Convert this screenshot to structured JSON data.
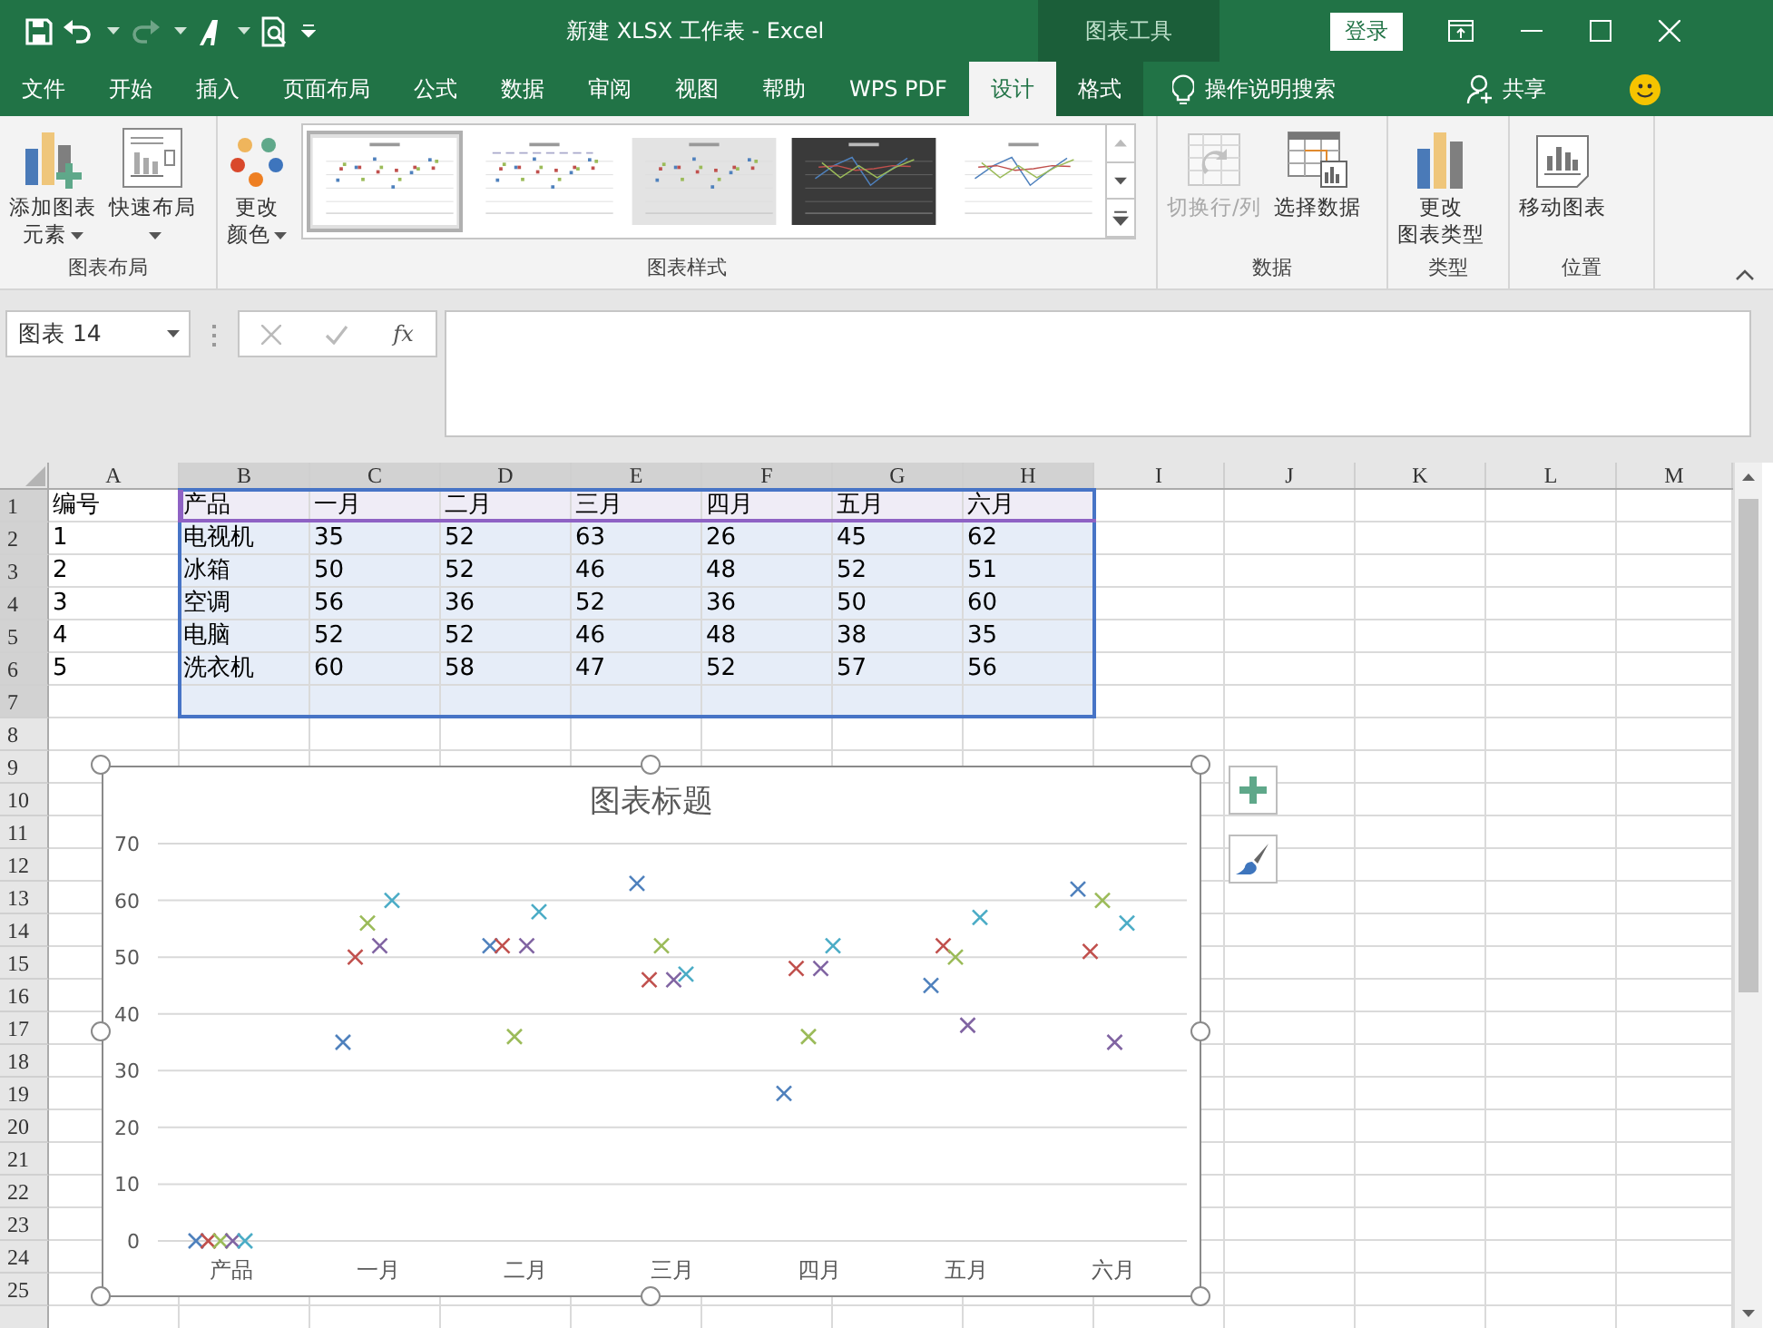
{
  "title_bar": {
    "title": "新建 XLSX 工作表  -  Excel",
    "context_label": "图表工具",
    "sign_in": "登录",
    "redo_disabled": true
  },
  "menu_tabs": [
    {
      "label": "文件",
      "selected": false,
      "context": false
    },
    {
      "label": "开始",
      "selected": false,
      "context": false
    },
    {
      "label": "插入",
      "selected": false,
      "context": false
    },
    {
      "label": "页面布局",
      "selected": false,
      "context": false
    },
    {
      "label": "公式",
      "selected": false,
      "context": false
    },
    {
      "label": "数据",
      "selected": false,
      "context": false
    },
    {
      "label": "审阅",
      "selected": false,
      "context": false
    },
    {
      "label": "视图",
      "selected": false,
      "context": false
    },
    {
      "label": "帮助",
      "selected": false,
      "context": false
    },
    {
      "label": "WPS PDF",
      "selected": false,
      "context": false
    },
    {
      "label": "设计",
      "selected": true,
      "context": true
    },
    {
      "label": "格式",
      "selected": false,
      "context": true
    }
  ],
  "tell_me": "操作说明搜索",
  "share": "共享",
  "ribbon_groups": [
    {
      "label": "图表布局",
      "items": [
        {
          "kind": "button",
          "lines": [
            "添加图表",
            "元素"
          ],
          "dropdown": true,
          "disabled": false
        },
        {
          "kind": "button",
          "lines": [
            "快速布局"
          ],
          "dropdown": true,
          "disabled": false
        }
      ]
    },
    {
      "label": "图表样式",
      "items": [
        {
          "kind": "button",
          "lines": [
            "更改",
            "颜色"
          ],
          "dropdown": true,
          "disabled": false
        },
        {
          "kind": "gallery",
          "styles": [
            {
              "kind": "plain",
              "selected": true
            },
            {
              "kind": "legend",
              "selected": false
            },
            {
              "kind": "gradient",
              "selected": false
            },
            {
              "kind": "dark",
              "selected": false
            },
            {
              "kind": "lines",
              "selected": false
            }
          ]
        }
      ]
    },
    {
      "label": "数据",
      "items": [
        {
          "kind": "button",
          "lines": [
            "切换行/列"
          ],
          "dropdown": false,
          "disabled": true
        },
        {
          "kind": "button",
          "lines": [
            "选择数据"
          ],
          "dropdown": false,
          "disabled": false
        }
      ]
    },
    {
      "label": "类型",
      "items": [
        {
          "kind": "button",
          "lines": [
            "更改",
            "图表类型"
          ],
          "dropdown": false,
          "disabled": false
        }
      ]
    },
    {
      "label": "位置",
      "items": [
        {
          "kind": "button",
          "lines": [
            "移动图表"
          ],
          "dropdown": false,
          "disabled": false
        }
      ]
    }
  ],
  "formula_bar": {
    "name_box": "图表 14",
    "function_label": "fx"
  },
  "sheet": {
    "columns": [
      {
        "letter": "A",
        "in_range": false
      },
      {
        "letter": "B",
        "in_range": true
      },
      {
        "letter": "C",
        "in_range": true
      },
      {
        "letter": "D",
        "in_range": true
      },
      {
        "letter": "E",
        "in_range": true
      },
      {
        "letter": "F",
        "in_range": true
      },
      {
        "letter": "G",
        "in_range": true
      },
      {
        "letter": "H",
        "in_range": true
      },
      {
        "letter": "I",
        "in_range": false
      },
      {
        "letter": "J",
        "in_range": false
      },
      {
        "letter": "K",
        "in_range": false
      },
      {
        "letter": "L",
        "in_range": false
      },
      {
        "letter": "M",
        "in_range": false
      }
    ],
    "rows": [
      {
        "number": "1",
        "in_range": true,
        "names_row": true,
        "cells": [
          "编号",
          "产品",
          "一月",
          "二月",
          "三月",
          "四月",
          "五月",
          "六月"
        ]
      },
      {
        "number": "2",
        "in_range": true,
        "names_row": false,
        "cells": [
          "1",
          "电视机",
          "35",
          "52",
          "63",
          "26",
          "45",
          "62"
        ]
      },
      {
        "number": "3",
        "in_range": true,
        "names_row": false,
        "cells": [
          "2",
          "冰箱",
          "50",
          "52",
          "46",
          "48",
          "52",
          "51"
        ]
      },
      {
        "number": "4",
        "in_range": true,
        "names_row": false,
        "cells": [
          "3",
          "空调",
          "56",
          "36",
          "52",
          "36",
          "50",
          "60"
        ]
      },
      {
        "number": "5",
        "in_range": true,
        "names_row": false,
        "cells": [
          "4",
          "电脑",
          "52",
          "52",
          "46",
          "48",
          "38",
          "35"
        ]
      },
      {
        "number": "6",
        "in_range": true,
        "names_row": false,
        "cells": [
          "5",
          "洗衣机",
          "60",
          "58",
          "47",
          "52",
          "57",
          "56"
        ]
      },
      {
        "number": "7",
        "in_range": true,
        "names_row": false
      },
      {
        "number": "8",
        "in_range": false
      },
      {
        "number": "9",
        "in_range": false
      },
      {
        "number": "10",
        "in_range": false
      },
      {
        "number": "11",
        "in_range": false
      },
      {
        "number": "12",
        "in_range": false
      },
      {
        "number": "13",
        "in_range": false
      },
      {
        "number": "14",
        "in_range": false
      },
      {
        "number": "15",
        "in_range": false
      },
      {
        "number": "16",
        "in_range": false
      },
      {
        "number": "17",
        "in_range": false
      },
      {
        "number": "18",
        "in_range": false
      },
      {
        "number": "19",
        "in_range": false
      },
      {
        "number": "20",
        "in_range": false
      },
      {
        "number": "21",
        "in_range": false
      },
      {
        "number": "22",
        "in_range": false
      },
      {
        "number": "23",
        "in_range": false
      },
      {
        "number": "24",
        "in_range": false
      },
      {
        "number": "25",
        "in_range": false
      }
    ]
  },
  "chart": {
    "title": "图表标题",
    "chart_data": {
      "type": "scatter",
      "grid": true,
      "categories": [
        "产品",
        "一月",
        "二月",
        "三月",
        "四月",
        "五月",
        "六月"
      ],
      "ylim": [
        0,
        70
      ],
      "yticks": [
        0,
        10,
        20,
        30,
        40,
        50,
        60,
        70
      ],
      "series": [
        {
          "color": "#4f81bd",
          "values": [
            0,
            35,
            52,
            63,
            26,
            45,
            62
          ]
        },
        {
          "color": "#c0504d",
          "values": [
            0,
            50,
            52,
            46,
            48,
            52,
            51
          ]
        },
        {
          "color": "#9bbb59",
          "values": [
            0,
            56,
            36,
            52,
            36,
            50,
            60
          ]
        },
        {
          "color": "#8064a2",
          "values": [
            0,
            52,
            52,
            46,
            48,
            38,
            35
          ]
        },
        {
          "color": "#4bacc6",
          "values": [
            0,
            60,
            58,
            47,
            52,
            57,
            56
          ]
        }
      ]
    }
  }
}
